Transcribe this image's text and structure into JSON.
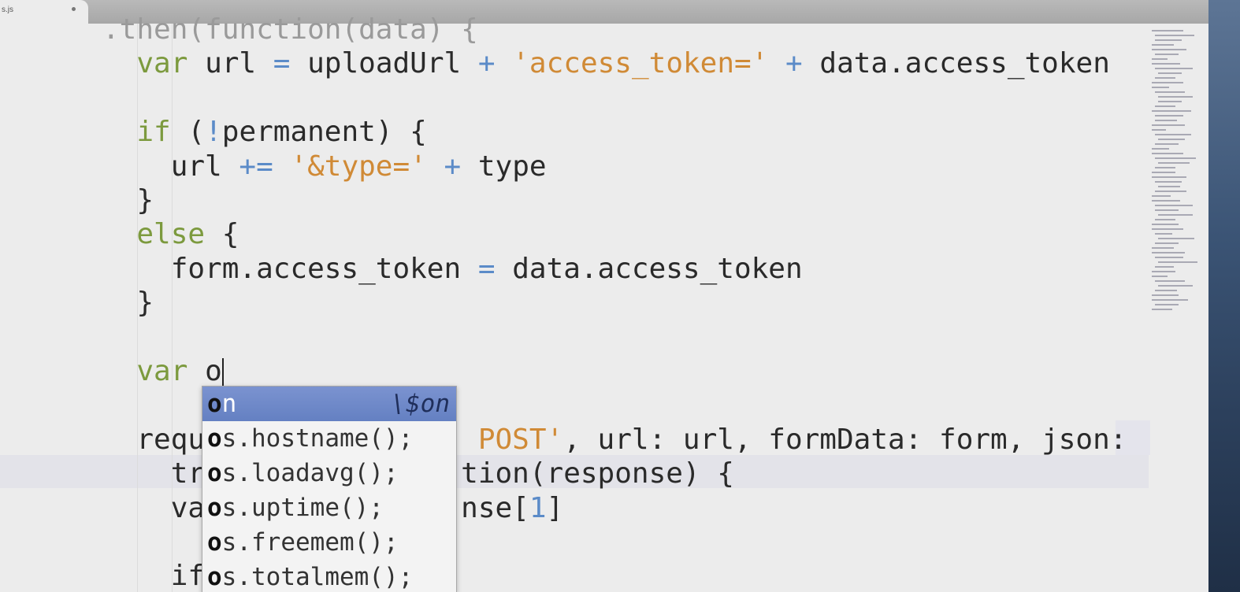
{
  "tab": {
    "label": "s.js"
  },
  "code_lines": [
    {
      "parts": [
        {
          "t": ".then(function(data) {",
          "c": "dim"
        }
      ]
    },
    {
      "parts": [
        {
          "t": "  ",
          "c": ""
        },
        {
          "t": "var",
          "c": "kw"
        },
        {
          "t": " url ",
          "c": ""
        },
        {
          "t": "=",
          "c": "op"
        },
        {
          "t": " uploadUrl ",
          "c": ""
        },
        {
          "t": "+",
          "c": "op"
        },
        {
          "t": " ",
          "c": ""
        },
        {
          "t": "'access_token='",
          "c": "str"
        },
        {
          "t": " ",
          "c": ""
        },
        {
          "t": "+",
          "c": "op"
        },
        {
          "t": " data.access_token",
          "c": ""
        }
      ]
    },
    {
      "parts": [
        {
          "t": "",
          "c": ""
        }
      ]
    },
    {
      "parts": [
        {
          "t": "  ",
          "c": ""
        },
        {
          "t": "if",
          "c": "kw"
        },
        {
          "t": " (",
          "c": ""
        },
        {
          "t": "!",
          "c": "op"
        },
        {
          "t": "permanent) {",
          "c": ""
        }
      ]
    },
    {
      "parts": [
        {
          "t": "    url ",
          "c": ""
        },
        {
          "t": "+=",
          "c": "op"
        },
        {
          "t": " ",
          "c": ""
        },
        {
          "t": "'&type='",
          "c": "str"
        },
        {
          "t": " ",
          "c": ""
        },
        {
          "t": "+",
          "c": "op"
        },
        {
          "t": " type",
          "c": ""
        }
      ]
    },
    {
      "parts": [
        {
          "t": "  }",
          "c": ""
        }
      ]
    },
    {
      "parts": [
        {
          "t": "  ",
          "c": ""
        },
        {
          "t": "else",
          "c": "kw"
        },
        {
          "t": " {",
          "c": ""
        }
      ]
    },
    {
      "parts": [
        {
          "t": "    form.access_token ",
          "c": ""
        },
        {
          "t": "=",
          "c": "op"
        },
        {
          "t": " data.access_token",
          "c": ""
        }
      ]
    },
    {
      "parts": [
        {
          "t": "  }",
          "c": ""
        }
      ]
    },
    {
      "parts": [
        {
          "t": "",
          "c": ""
        }
      ]
    },
    {
      "parts": [
        {
          "t": "  ",
          "c": ""
        },
        {
          "t": "var",
          "c": "kw"
        },
        {
          "t": " o",
          "c": ""
        }
      ],
      "cursor": true
    },
    {
      "parts": [
        {
          "t": "",
          "c": ""
        }
      ]
    },
    {
      "parts": [
        {
          "t": "  requ",
          "c": ""
        },
        {
          "t": "                ",
          "c": ""
        },
        {
          "t": "POST'",
          "c": "str"
        },
        {
          "t": ", url: url, formData: form, json:",
          "c": ""
        }
      ]
    },
    {
      "parts": [
        {
          "t": "    tr",
          "c": ""
        },
        {
          "t": "               ",
          "c": ""
        },
        {
          "t": "tion(response) {",
          "c": ""
        }
      ]
    },
    {
      "parts": [
        {
          "t": "    va",
          "c": ""
        },
        {
          "t": "               ",
          "c": ""
        },
        {
          "t": "nse[",
          "c": ""
        },
        {
          "t": "1",
          "c": "num"
        },
        {
          "t": "]",
          "c": ""
        }
      ]
    },
    {
      "parts": [
        {
          "t": "",
          "c": ""
        }
      ]
    },
    {
      "parts": [
        {
          "t": "    if",
          "c": ""
        }
      ]
    }
  ],
  "autocomplete": {
    "items": [
      {
        "match": "o",
        "rest": "n",
        "hint": "\\$on",
        "selected": true
      },
      {
        "match": "o",
        "rest": "s.hostname();",
        "hint": "",
        "selected": false
      },
      {
        "match": "o",
        "rest": "s.loadavg();",
        "hint": "",
        "selected": false
      },
      {
        "match": "o",
        "rest": "s.uptime();",
        "hint": "",
        "selected": false
      },
      {
        "match": "o",
        "rest": "s.freemem();",
        "hint": "",
        "selected": false
      },
      {
        "match": "o",
        "rest": "s.totalmem();",
        "hint": "",
        "selected": false
      }
    ]
  },
  "colors": {
    "keyword": "#7c9a3e",
    "operator": "#5b8bc8",
    "string": "#d08a36",
    "selection": "#6a86c8"
  }
}
